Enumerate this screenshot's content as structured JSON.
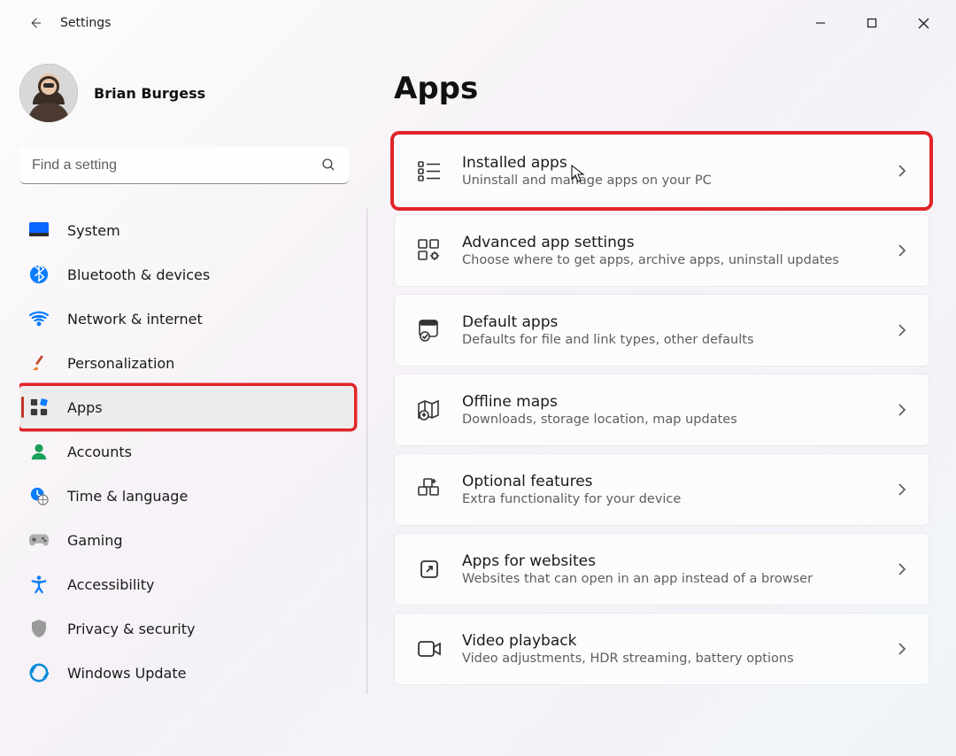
{
  "window": {
    "title": "Settings"
  },
  "user": {
    "name": "Brian Burgess"
  },
  "search": {
    "placeholder": "Find a setting"
  },
  "nav": {
    "items": [
      {
        "id": "system",
        "label": "System"
      },
      {
        "id": "bluetooth",
        "label": "Bluetooth & devices"
      },
      {
        "id": "network",
        "label": "Network & internet"
      },
      {
        "id": "personalization",
        "label": "Personalization"
      },
      {
        "id": "apps",
        "label": "Apps"
      },
      {
        "id": "accounts",
        "label": "Accounts"
      },
      {
        "id": "time",
        "label": "Time & language"
      },
      {
        "id": "gaming",
        "label": "Gaming"
      },
      {
        "id": "accessibility",
        "label": "Accessibility"
      },
      {
        "id": "privacy",
        "label": "Privacy & security"
      },
      {
        "id": "update",
        "label": "Windows Update"
      }
    ],
    "selected": "apps"
  },
  "page": {
    "title": "Apps",
    "highlighted_card": "installed-apps",
    "cards": [
      {
        "id": "installed-apps",
        "title": "Installed apps",
        "sub": "Uninstall and manage apps on your PC"
      },
      {
        "id": "advanced",
        "title": "Advanced app settings",
        "sub": "Choose where to get apps, archive apps, uninstall updates"
      },
      {
        "id": "default-apps",
        "title": "Default apps",
        "sub": "Defaults for file and link types, other defaults"
      },
      {
        "id": "offline-maps",
        "title": "Offline maps",
        "sub": "Downloads, storage location, map updates"
      },
      {
        "id": "optional",
        "title": "Optional features",
        "sub": "Extra functionality for your device"
      },
      {
        "id": "apps-websites",
        "title": "Apps for websites",
        "sub": "Websites that can open in an app instead of a browser"
      },
      {
        "id": "video-playback",
        "title": "Video playback",
        "sub": "Video adjustments, HDR streaming, battery options"
      }
    ]
  }
}
